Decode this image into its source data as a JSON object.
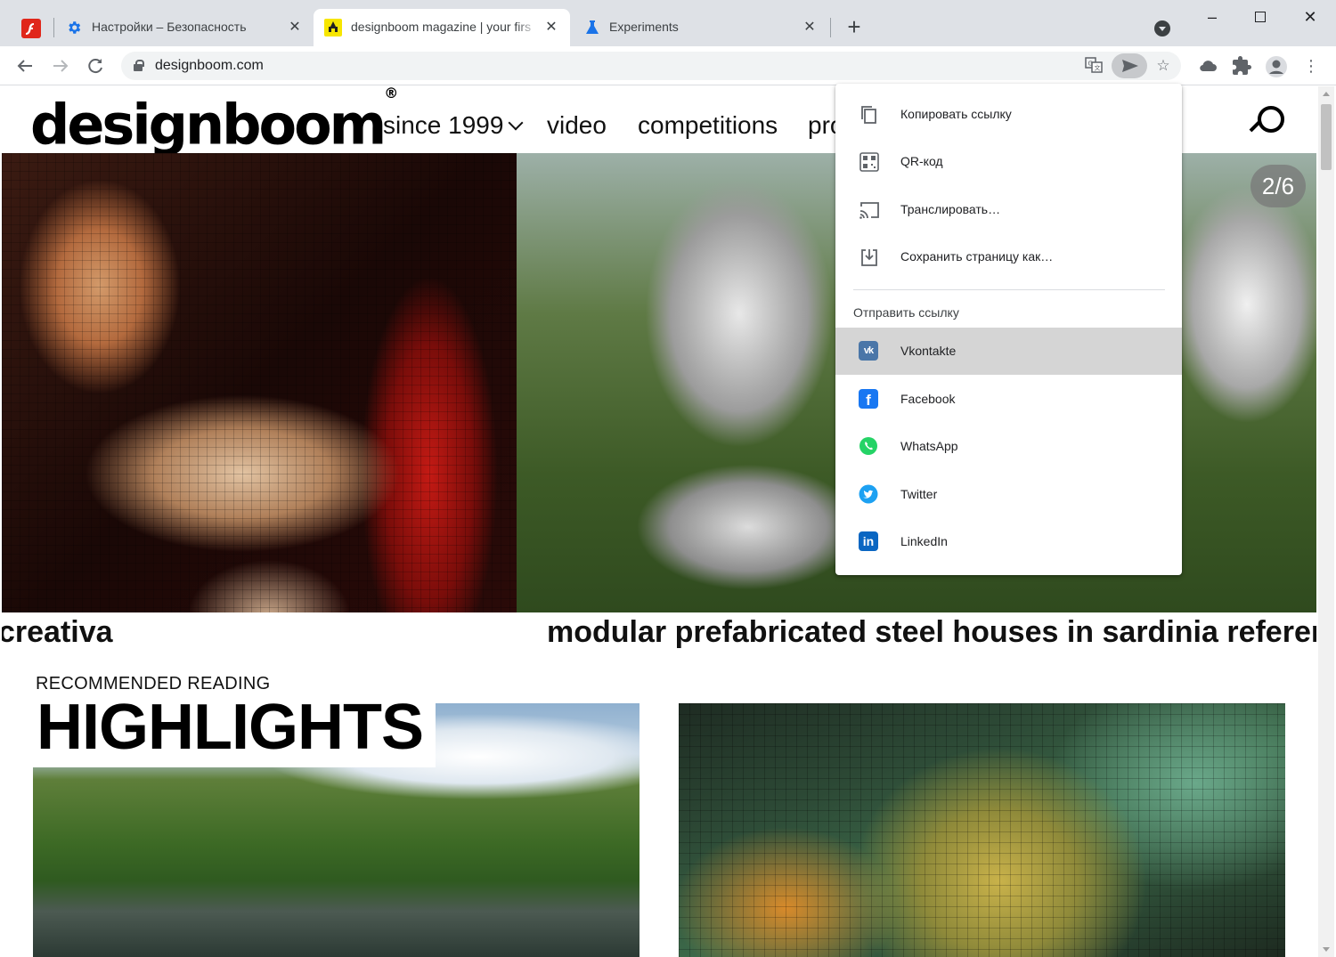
{
  "tabs": [
    {
      "title": "Настройки – Безопасность",
      "favicon": "gear-icon"
    },
    {
      "title": "designboom magazine | your firs",
      "favicon": "designboom-icon"
    },
    {
      "title": "Experiments",
      "favicon": "flask-icon"
    }
  ],
  "address": {
    "url": "designboom.com"
  },
  "site": {
    "logo": "designboom",
    "logo_mark": "®",
    "nav": [
      "since 1999",
      "video",
      "competitions",
      "pro"
    ],
    "slide_counter": "2/6",
    "captions": [
      "creativa",
      "modular prefabricated steel houses in sardinia reference t"
    ],
    "section_label": "RECOMMENDED READING",
    "section_title": "HIGHLIGHTS"
  },
  "share_menu": {
    "items": [
      {
        "label": "Копировать ссылку",
        "icon": "copy-icon"
      },
      {
        "label": "QR-код",
        "icon": "qr-code-icon"
      },
      {
        "label": "Транслировать…",
        "icon": "cast-icon"
      },
      {
        "label": "Сохранить страницу как…",
        "icon": "save-page-icon"
      }
    ],
    "group_label": "Отправить ссылку",
    "targets": [
      {
        "label": "Vkontakte",
        "icon": "vk-icon",
        "color": "#4a76a8"
      },
      {
        "label": "Facebook",
        "icon": "facebook-icon",
        "color": "#1877f2"
      },
      {
        "label": "WhatsApp",
        "icon": "whatsapp-icon",
        "color": "#25d366"
      },
      {
        "label": "Twitter",
        "icon": "twitter-icon",
        "color": "#1da1f2"
      },
      {
        "label": "LinkedIn",
        "icon": "linkedin-icon",
        "color": "#0a66c2"
      }
    ]
  },
  "colors": {
    "tabstrip": "#dee1e6",
    "highlight_row": "#d5d5d5",
    "flash_red": "#e0271b"
  }
}
